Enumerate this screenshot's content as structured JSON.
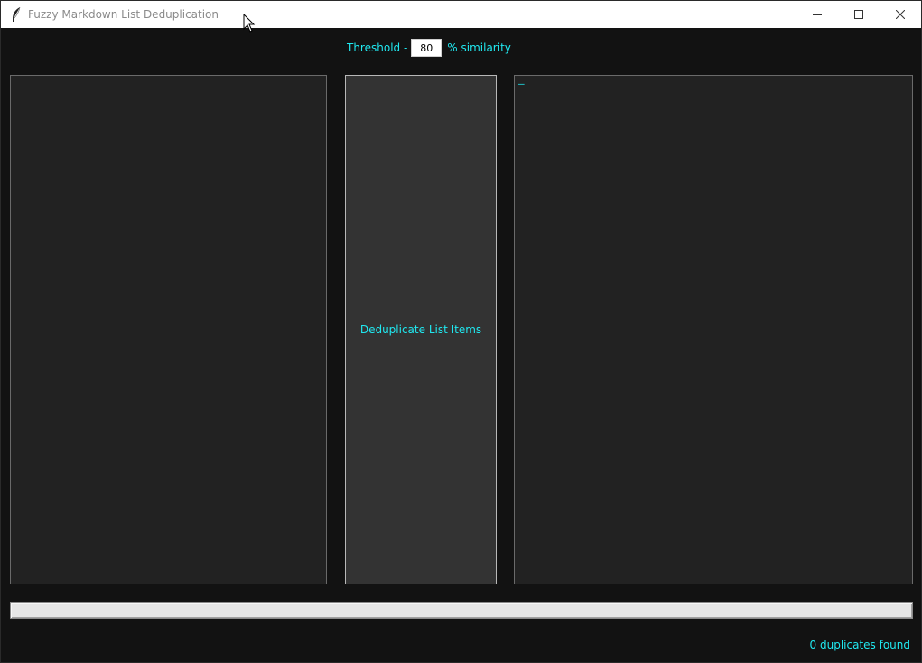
{
  "window": {
    "title": "Fuzzy Markdown List Deduplication"
  },
  "threshold": {
    "label_before": "Threshold -",
    "value": "80",
    "label_after": "% similarity"
  },
  "output": {
    "text": "–"
  },
  "actions": {
    "dedup_label": "Deduplicate List Items"
  },
  "progress": {
    "fraction": 0
  },
  "status": {
    "text": "0 duplicates found"
  },
  "colors": {
    "accent": "#20e8f0",
    "background": "#121212",
    "panel": "#222222",
    "button": "#333333"
  },
  "icons": {
    "app": "feather-icon",
    "minimize": "minimize-icon",
    "maximize": "maximize-icon",
    "close": "close-icon"
  }
}
